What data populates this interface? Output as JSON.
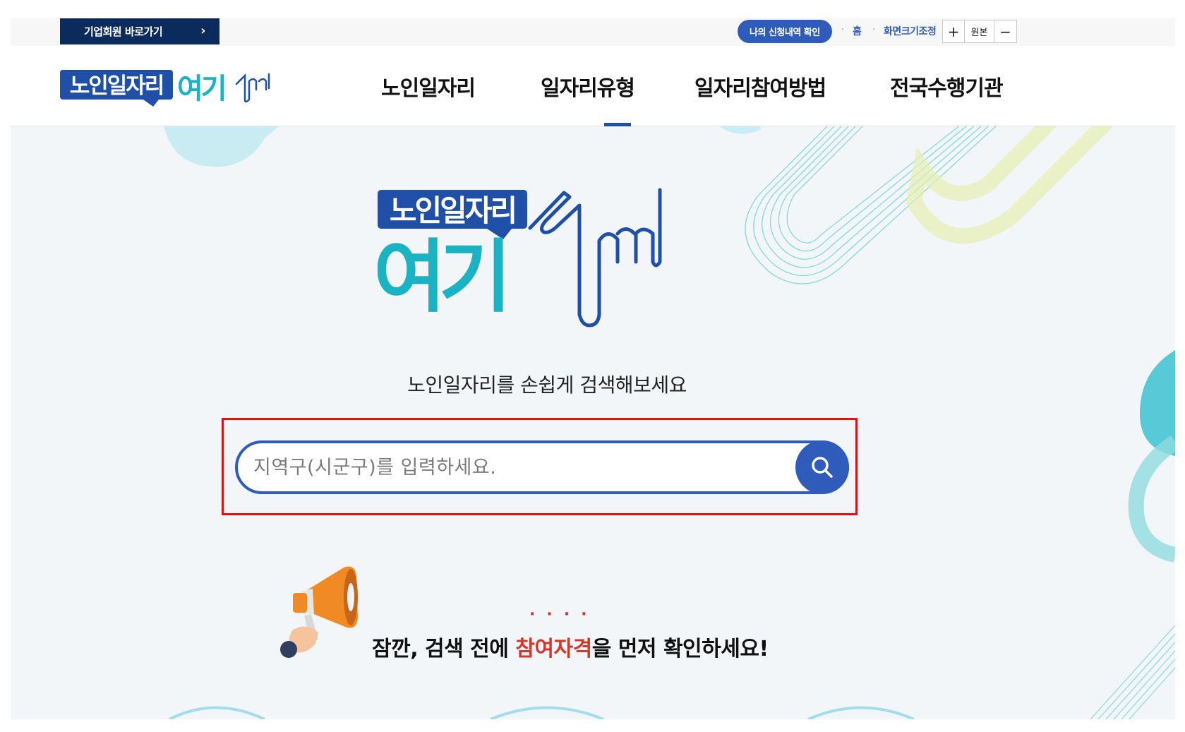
{
  "utility": {
    "corp_link": "기업회원 바로가기",
    "my_apply": "나의 신청내역 확인",
    "home": "홈",
    "zoom_label": "화면크기조정",
    "zoom_in": "+",
    "zoom_reset": "원본",
    "zoom_out": "−"
  },
  "brand": {
    "logo_top": "노인일자리",
    "logo_bottom": "여기",
    "primary_color": "#1f4fa7",
    "teal_color": "#19b3c4"
  },
  "nav": {
    "items": [
      {
        "label": "노인일자리",
        "active": false
      },
      {
        "label": "일자리유형",
        "active": true
      },
      {
        "label": "일자리참여방법",
        "active": false
      },
      {
        "label": "전국수행기관",
        "active": false
      }
    ]
  },
  "hero": {
    "title": "노인일자리를 손쉽게 검색해보세요",
    "search_placeholder": "지역구(시군구)를 입력하세요.",
    "search_value": "",
    "notice_pre": "잠깐, 검색 전에 ",
    "notice_highlight": "참여자격",
    "notice_post": "을 먼저 확인하세요!",
    "notice_dots": "····"
  }
}
